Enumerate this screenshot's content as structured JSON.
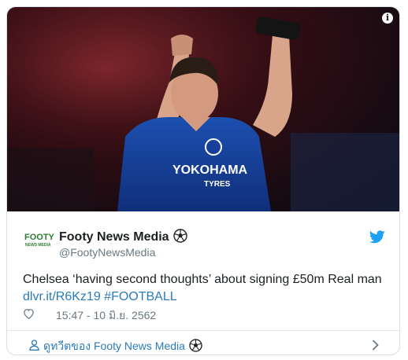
{
  "media": {
    "description_icon": "info-icon"
  },
  "author": {
    "logo_top": "FOOTY",
    "logo_bottom": "NEWS MEDIA",
    "name": "Footy News Media",
    "handle": "@FootyNewsMedia",
    "name_emoji_icon": "soccer-ball-icon"
  },
  "tweet": {
    "text": "Chelsea ‘having second thoughts’ about signing £50m Real man",
    "link": "dlvr.it/R6Kz19",
    "hashtag": "#FOOTBALL",
    "timestamp": "15:47 - 10 มิ.ย. 2562"
  },
  "footer": {
    "label": "ดูทวีตของ Footy News Media"
  },
  "colors": {
    "link": "#2b7bb9",
    "text": "#1c2022",
    "muted": "#697882",
    "twitter_blue": "#1da1f2"
  }
}
